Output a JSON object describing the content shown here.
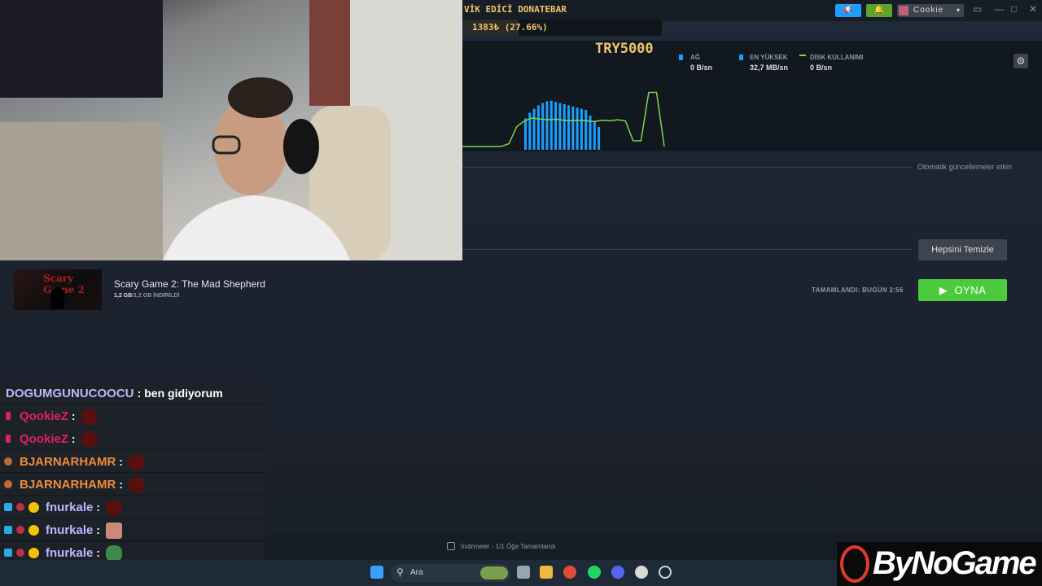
{
  "topbar": {
    "user_name": "Cookie",
    "announce_icon": "megaphone-icon",
    "notif_icon": "bell-icon"
  },
  "donation": {
    "title": "VİK EDİCİ DONATEBAR",
    "amount": "1383₺ (27.66%)",
    "progress": 0.2766,
    "goal": "TRY5000"
  },
  "network_graph": {
    "legend": [
      {
        "label": "AĞ",
        "value": "0 B/sn"
      },
      {
        "label": "EN YÜKSEK",
        "value": "32,7 MB/sn"
      },
      {
        "label": "DİSK KULLANIMI",
        "value": "0 B/sn"
      }
    ],
    "bars": [
      0.55,
      0.65,
      0.72,
      0.78,
      0.82,
      0.85,
      0.86,
      0.84,
      0.82,
      0.8,
      0.78,
      0.76,
      0.74,
      0.72,
      0.7,
      0.6,
      0.5,
      0.4
    ],
    "disk_line": [
      0,
      0,
      0,
      0,
      0,
      0,
      0.05,
      0.35,
      0.45,
      0.5,
      0.48,
      0.47,
      0.48,
      0.46,
      0.45,
      0.46,
      0.45,
      0.44,
      0.46,
      0.45,
      0.47,
      0.45,
      0.1,
      0.1,
      0.95,
      0.95,
      0
    ]
  },
  "downloads": {
    "auto_updates": "Otomatik güncellemeler etkin",
    "clear_all": "Hepsini Temizle",
    "game_title": "Scary Game 2: The Mad Shepherd",
    "thumb_title": "Scary Game 2",
    "size_done": "1,2 GB",
    "size_total": "/1,2 GB İNDİRİLDİ",
    "completed": "TAMAMLANDI: BUGÜN 2:56",
    "play": "OYNA",
    "status": "İndirmeler - 1/1 Öğe Tamamlandı"
  },
  "chat": [
    {
      "user": "DOGUMGUNUCOOCU",
      "text": "ben gidiyorum",
      "color": "#b8b9ff"
    },
    {
      "user": "QookieZ",
      "text": "",
      "color": "#e0215f"
    },
    {
      "user": "QookieZ",
      "text": "",
      "color": "#e0215f"
    },
    {
      "user": "BJARNARHAMR",
      "text": "",
      "color": "#f08a3b"
    },
    {
      "user": "BJARNARHAMR",
      "text": "",
      "color": "#f08a3b"
    },
    {
      "user": "fnurkale",
      "text": "",
      "color": "#b8b9ff"
    },
    {
      "user": "fnurkale",
      "text": "",
      "color": "#b8b9ff"
    },
    {
      "user": "fnurkale",
      "text": "",
      "color": "#b8b9ff"
    },
    {
      "user": "fnurkale",
      "text": "",
      "color": "#b8b9ff"
    }
  ],
  "taskbar": {
    "search_label": "Ara"
  },
  "logo": "ByNoGame"
}
